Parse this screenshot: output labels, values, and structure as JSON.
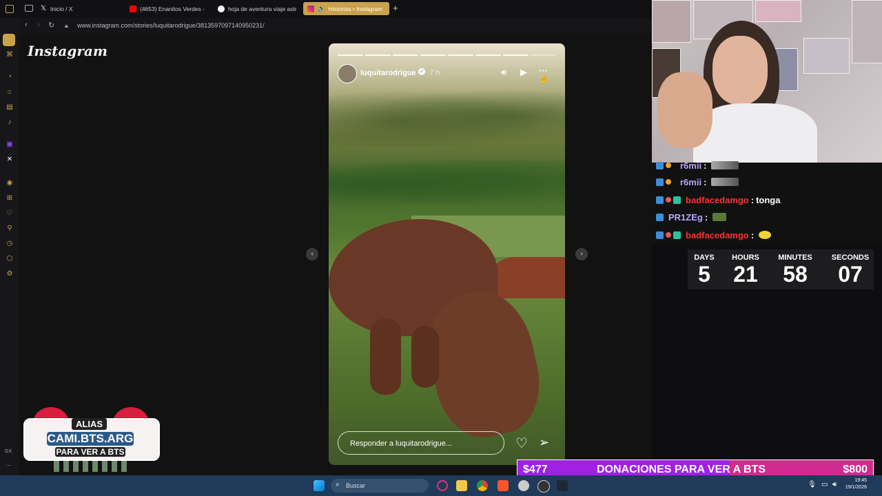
{
  "browser": {
    "tabs": [
      {
        "label": "Inicio / X",
        "icon": "x-icon",
        "color": "#ffffff"
      },
      {
        "label": "(4653) Enanitos Verdes -",
        "icon": "youtube-icon",
        "color": "#ff0000"
      },
      {
        "label": "hoja de aventura viaje astr",
        "icon": "google-icon",
        "color": "#4285f4"
      },
      {
        "label": "Historias • Instagram",
        "icon": "instagram-icon",
        "color": "#e1306c"
      }
    ],
    "new_tab": "+",
    "url": "www.instagram.com/stories/luquitarodrigue/3813597097140950231/"
  },
  "page": {
    "logo": "Instagram",
    "story": {
      "username": "luquitarodrigue",
      "time": "7 h",
      "reply_placeholder": "Responder a luquitarodrigue...",
      "segments_total": 8,
      "segments_seen": 7
    }
  },
  "sidebar": {
    "bottom_label": "GX"
  },
  "chat": {
    "messages": [
      {
        "user": "r6mii",
        "color": "#b9a6ff",
        "text": ""
      },
      {
        "user": "r6mii",
        "color": "#b9a6ff",
        "text": ""
      },
      {
        "user": "badfacedamgo",
        "color": "#ff3030",
        "text": "tonga"
      },
      {
        "user": "PR1ZEg",
        "color": "#b9a6ff",
        "text": ""
      },
      {
        "user": "badfacedamgo",
        "color": "#ff3030",
        "text": ""
      }
    ],
    "separator": ":"
  },
  "countdown": {
    "days_label": "DAYS",
    "days": "5",
    "hours_label": "HOURS",
    "hours": "21",
    "minutes_label": "MINUTES",
    "minutes": "58",
    "seconds_label": "SECONDS",
    "seconds": "07"
  },
  "overlay": {
    "alias_label": "ALIAS",
    "alias_value": "CAMI.BTS.ARG",
    "alias_caption": "PARA VER A BTS"
  },
  "donation": {
    "current": "$477",
    "title": "DONACIONES PARA VER A BTS",
    "goal": "$800",
    "progress": 0.596
  },
  "taskbar": {
    "search_placeholder": "Buscar",
    "time": "19:45",
    "date": "19/1/2026"
  },
  "colors": {
    "accent": "#c9a24b",
    "donation_fill": "#a020e6",
    "donation_bg": "#d12b8f"
  }
}
